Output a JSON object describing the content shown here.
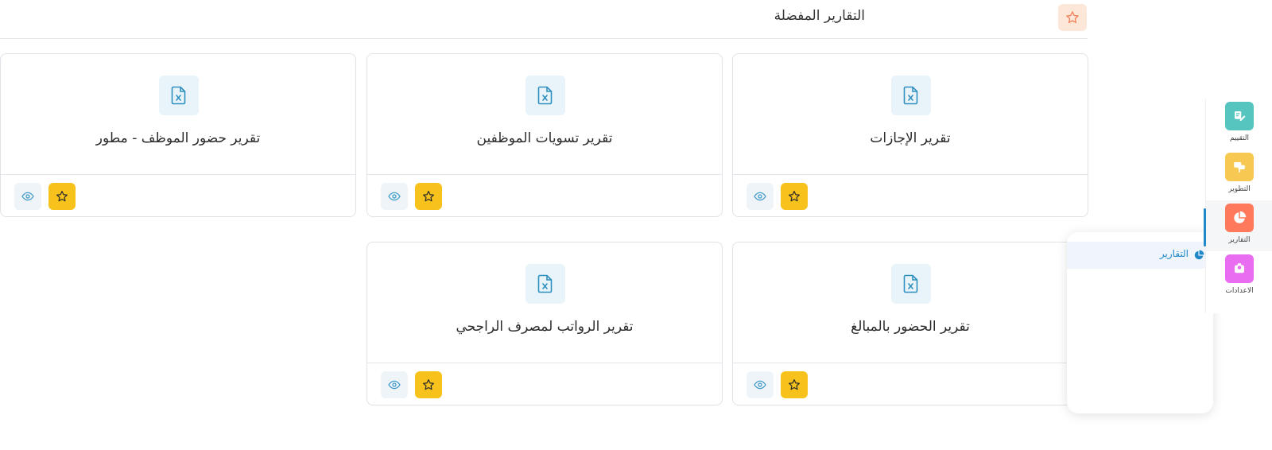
{
  "header": {
    "title": "التقارير المفضلة",
    "icon": "star-outline-icon"
  },
  "reports": [
    {
      "title": "تقرير الإجازات"
    },
    {
      "title": "تقرير تسويات الموظفين"
    },
    {
      "title": "تقرير حضور الموظف - مطور"
    },
    {
      "title": "تقرير الحضور بالمبالغ"
    },
    {
      "title": "تقرير الرواتب لمصرف الراجحي"
    }
  ],
  "sidebar": {
    "items": [
      {
        "label": "التقييم",
        "icon": "edit-note-icon",
        "color": "#56c5c0"
      },
      {
        "label": "التطوير",
        "icon": "presentation-icon",
        "color": "#f8c952"
      },
      {
        "label": "التقارير",
        "icon": "pie-chart-icon",
        "color": "#ff7a5c"
      },
      {
        "label": "الاعدادات",
        "icon": "settings-icon",
        "color": "#e96df0"
      }
    ]
  },
  "submenu": {
    "items": [
      {
        "label": "التقارير",
        "icon": "pie-chart-icon"
      }
    ]
  },
  "colors": {
    "accent": "#1e88c8",
    "favorite": "#f7c21b",
    "header_icon_bg": "#fde7d8"
  }
}
